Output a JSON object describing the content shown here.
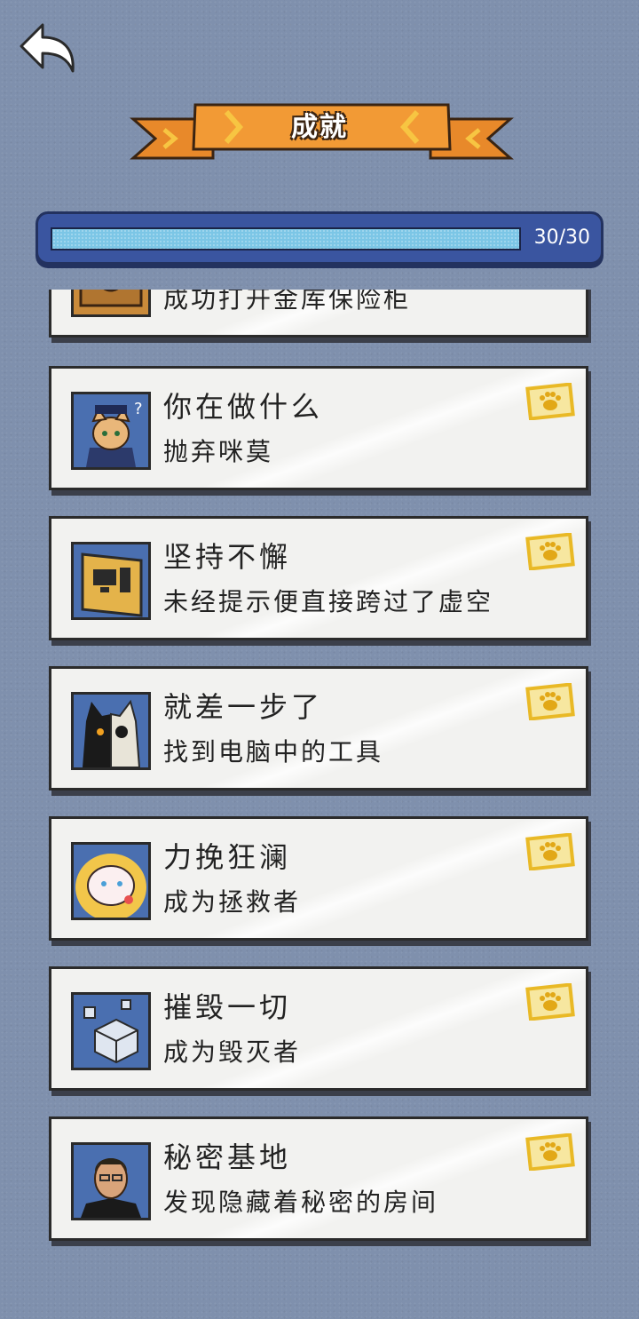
{
  "header": {
    "title": "成就",
    "back_icon": "back-arrow-icon"
  },
  "progress": {
    "value": 30,
    "max": 30,
    "label": "30/30",
    "fill_color": "#7cc6e6"
  },
  "achievements": [
    {
      "title": "",
      "desc": "成功打开金库保险柜",
      "thumb": "safe-icon",
      "unlocked": true
    },
    {
      "title": "你在做什么",
      "desc": "抛弃咪莫",
      "thumb": "police-cat-icon",
      "unlocked": true
    },
    {
      "title": "坚持不懈",
      "desc": "未经提示便直接跨过了虚空",
      "thumb": "computer-monitor-icon",
      "unlocked": true
    },
    {
      "title": "就差一步了",
      "desc": "找到电脑中的工具",
      "thumb": "skull-cat-icon",
      "unlocked": true
    },
    {
      "title": "力挽狂澜",
      "desc": "成为拯救者",
      "thumb": "baby-cat-icon",
      "unlocked": true
    },
    {
      "title": "摧毁一切",
      "desc": "成为毁灭者",
      "thumb": "cubes-icon",
      "unlocked": true
    },
    {
      "title": "秘密基地",
      "desc": "发现隐藏着秘密的房间",
      "thumb": "man-portrait-icon",
      "unlocked": true
    }
  ]
}
